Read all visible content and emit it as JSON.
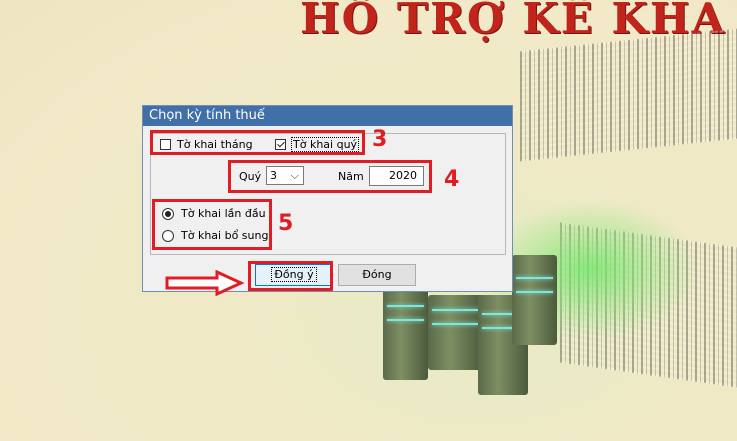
{
  "background": {
    "title": "HỖ TRỢ KÊ KHA",
    "accent_color": "#c0241b"
  },
  "dialog": {
    "title": "Chọn kỳ tính thuế",
    "checkbox_monthly": {
      "label": "Tờ khai tháng",
      "checked": false
    },
    "checkbox_quarterly": {
      "label": "Tờ khai quý",
      "checked": true
    },
    "quarter": {
      "label": "Quý",
      "value": "3"
    },
    "year": {
      "label": "Năm",
      "value": "2020"
    },
    "radio_first": {
      "label": "Tờ khai lần đầu",
      "selected": true
    },
    "radio_supplement": {
      "label": "Tờ khai bổ sung",
      "selected": false
    },
    "ok_button": "Đồng ý",
    "close_button": "Đóng"
  },
  "annotations": {
    "step3": "3",
    "step4": "4",
    "step5": "5",
    "color": "#e01d24",
    "arrow": "right-arrow-icon"
  }
}
